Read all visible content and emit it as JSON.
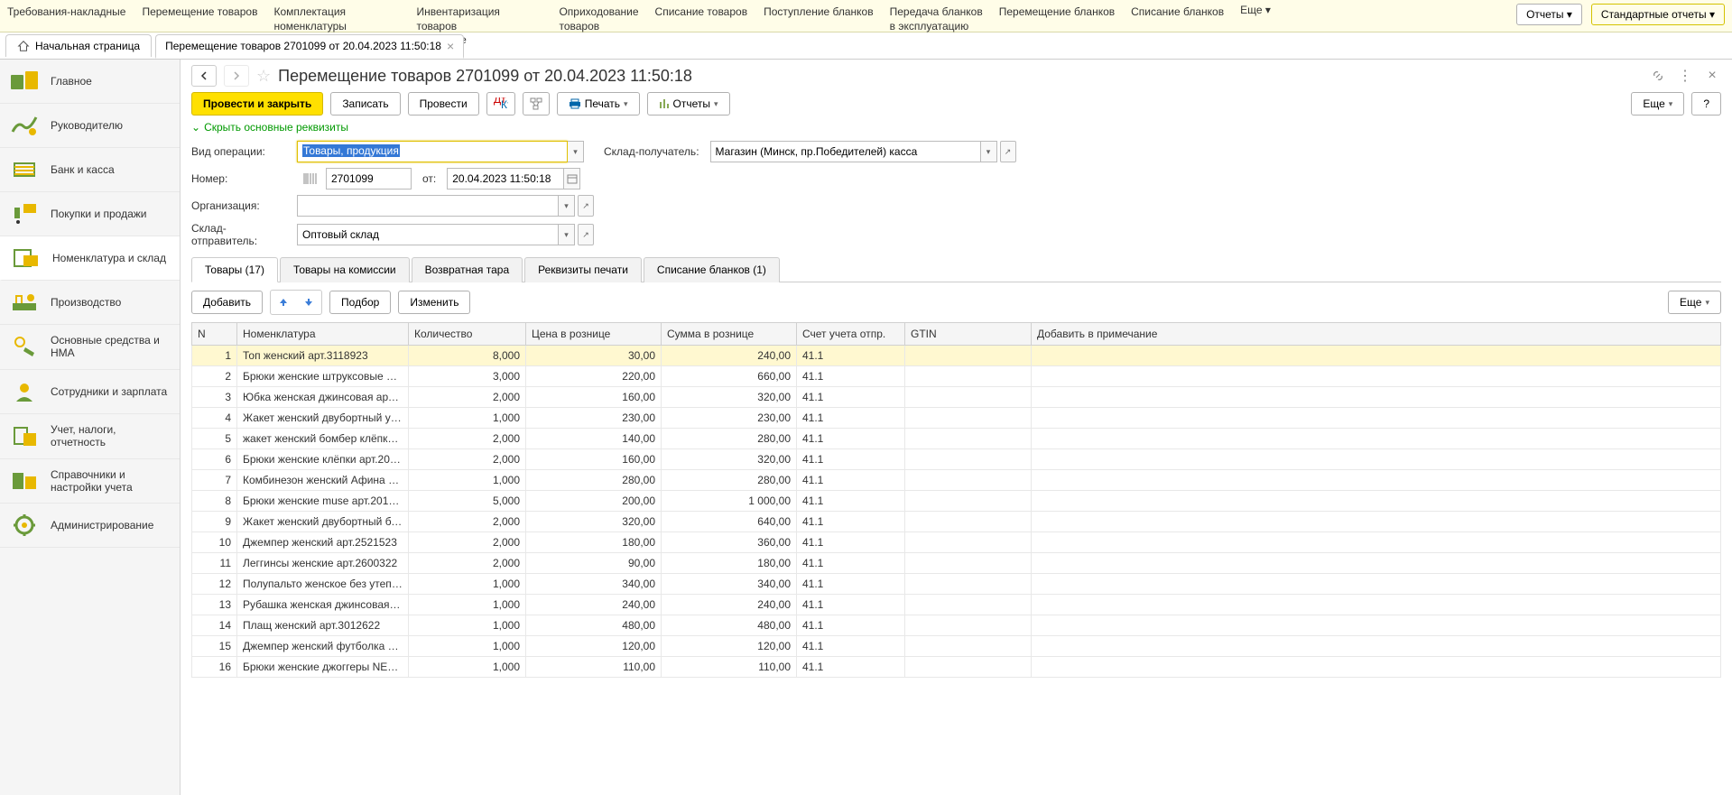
{
  "topMenu": {
    "items": [
      "Требования-накладные",
      "Перемещение товаров",
      "Комплектация номенклатуры",
      "Инвентаризация товаров\nна складе",
      "Оприходование\nтоваров",
      "Списание товаров",
      "Поступление бланков",
      "Передача бланков\nв эксплуатацию",
      "Перемещение бланков",
      "Списание бланков"
    ],
    "more": "Еще ▾",
    "reports": "Отчеты ▾",
    "standardReports": "Стандартные отчеты ▾"
  },
  "docTabs": {
    "home": "Начальная страница",
    "current": "Перемещение товаров 2701099 от 20.04.2023 11:50:18"
  },
  "sidebar": {
    "items": [
      "Главное",
      "Руководителю",
      "Банк и касса",
      "Покупки и продажи",
      "Номенклатура и склад",
      "Производство",
      "Основные средства и НМА",
      "Сотрудники и зарплата",
      "Учет, налоги, отчетность",
      "Справочники и настройки учета",
      "Администрирование"
    ],
    "activeIndex": 4
  },
  "page": {
    "title": "Перемещение товаров 2701099 от 20.04.2023 11:50:18"
  },
  "toolbar": {
    "postAndClose": "Провести и закрыть",
    "save": "Записать",
    "post": "Провести",
    "print": "Печать",
    "reports": "Отчеты",
    "more": "Еще",
    "help": "?"
  },
  "toggle": "Скрыть основные реквизиты",
  "form": {
    "opTypeLabel": "Вид операции:",
    "opType": "Товары, продукция",
    "receiverLabel": "Склад-получатель:",
    "receiver": "Магазин (Минск, пр.Победителей) касса",
    "numberLabel": "Номер:",
    "number": "2701099",
    "fromLabel": "от:",
    "date": "20.04.2023 11:50:18",
    "orgLabel": "Организация:",
    "org": "",
    "senderLabel": "Склад-отправитель:",
    "sender": "Оптовый склад"
  },
  "tabs": [
    "Товары (17)",
    "Товары на комиссии",
    "Возвратная тара",
    "Реквизиты печати",
    "Списание бланков (1)"
  ],
  "tableToolbar": {
    "add": "Добавить",
    "pick": "Подбор",
    "edit": "Изменить",
    "more": "Еще"
  },
  "columns": {
    "n": "N",
    "name": "Номенклатура",
    "qty": "Количество",
    "price": "Цена в рознице",
    "sum": "Сумма в рознице",
    "acct": "Счет учета отпр.",
    "gtin": "GTIN",
    "note": "Добавить в примечание"
  },
  "rows": [
    {
      "n": 1,
      "name": "Топ женский арт.3118923",
      "qty": "8,000",
      "price": "30,00",
      "sum": "240,00",
      "acct": "41.1"
    },
    {
      "n": 2,
      "name": "Брюки женские штруксовые арт....",
      "qty": "3,000",
      "price": "220,00",
      "sum": "660,00",
      "acct": "41.1"
    },
    {
      "n": 3,
      "name": "Юбка женская джинсовая арт.21...",
      "qty": "2,000",
      "price": "160,00",
      "sum": "320,00",
      "acct": "41.1"
    },
    {
      "n": 4,
      "name": "Жакет женский двубортный укор...",
      "qty": "1,000",
      "price": "230,00",
      "sum": "230,00",
      "acct": "41.1"
    },
    {
      "n": 5,
      "name": "жакет женский бомбер клёпки ар...",
      "qty": "2,000",
      "price": "140,00",
      "sum": "280,00",
      "acct": "41.1"
    },
    {
      "n": 6,
      "name": "Брюки женские  клёпки арт.2002...",
      "qty": "2,000",
      "price": "160,00",
      "sum": "320,00",
      "acct": "41.1"
    },
    {
      "n": 7,
      "name": "Комбинезон женский Афина арт....",
      "qty": "1,000",
      "price": "280,00",
      "sum": "280,00",
      "acct": "41.1"
    },
    {
      "n": 8,
      "name": "Брюки женские muse арт.2010222",
      "qty": "5,000",
      "price": "200,00",
      "sum": "1 000,00",
      "acct": "41.1"
    },
    {
      "n": 9,
      "name": "Жакет женский двубортный база ...",
      "qty": "2,000",
      "price": "320,00",
      "sum": "640,00",
      "acct": "41.1"
    },
    {
      "n": 10,
      "name": "Джемпер женский арт.2521523",
      "qty": "2,000",
      "price": "180,00",
      "sum": "360,00",
      "acct": "41.1"
    },
    {
      "n": 11,
      "name": "Леггинсы женские  арт.2600322",
      "qty": "2,000",
      "price": "90,00",
      "sum": "180,00",
      "acct": "41.1"
    },
    {
      "n": 12,
      "name": "Полупальто женское без утеплит...",
      "qty": "1,000",
      "price": "340,00",
      "sum": "340,00",
      "acct": "41.1"
    },
    {
      "n": 13,
      "name": "Рубашка женская джинсовая арт....",
      "qty": "1,000",
      "price": "240,00",
      "sum": "240,00",
      "acct": "41.1"
    },
    {
      "n": 14,
      "name": "Плащ женский арт.3012622",
      "qty": "1,000",
      "price": "480,00",
      "sum": "480,00",
      "acct": "41.1"
    },
    {
      "n": 15,
      "name": "Джемпер женский футболка овер...",
      "qty": "1,000",
      "price": "120,00",
      "sum": "120,00",
      "acct": "41.1"
    },
    {
      "n": 16,
      "name": "Брюки женские джоггеры NEW а...",
      "qty": "1,000",
      "price": "110,00",
      "sum": "110,00",
      "acct": "41.1"
    }
  ]
}
